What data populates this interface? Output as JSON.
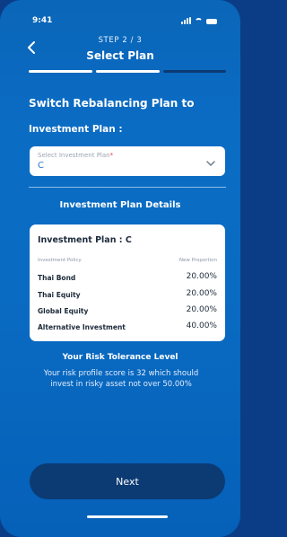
{
  "status": {
    "time": "9:41"
  },
  "header": {
    "step": "STEP 2 / 3",
    "title": "Select Plan",
    "progress_segments": 3,
    "active_step": 2
  },
  "main": {
    "heading": "Switch Rebalancing Plan to",
    "plan_label": "Investment Plan :",
    "select": {
      "placeholder": "Select Investment Plan",
      "required_mark": "*",
      "value": "C"
    },
    "details_title": "Investment Plan Details"
  },
  "card": {
    "title": "Investment Plan : C",
    "col_policy": "Investment Policy",
    "col_prop": "New Proportion",
    "rows": [
      {
        "policy": "Thai Bond",
        "value": "20.00%"
      },
      {
        "policy": "Thai Equity",
        "value": "20.00%"
      },
      {
        "policy": "Global Equity",
        "value": "20.00%"
      },
      {
        "policy": "Alternative Investment",
        "value": "40.00%"
      }
    ]
  },
  "risk": {
    "title": "Your Risk Tolerance Level",
    "text": "Your risk profile score is 32 which should invest in risky asset not over 50.00%"
  },
  "footer": {
    "next_label": "Next"
  },
  "colors": {
    "background": "#0a66b8",
    "next_button": "#0c3b73",
    "value_blue": "#2a78c8"
  }
}
